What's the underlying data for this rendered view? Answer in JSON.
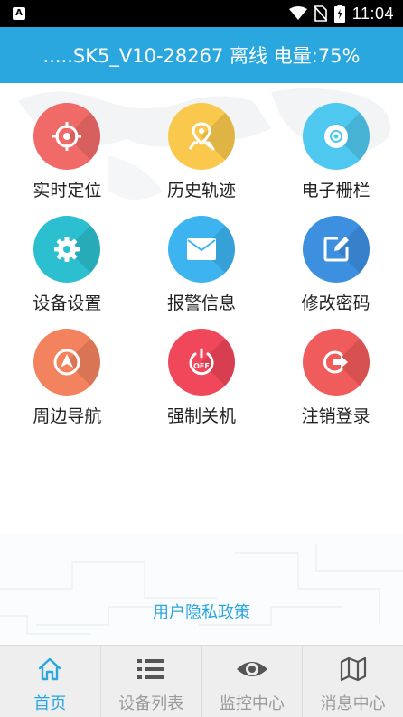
{
  "status_bar": {
    "time": "11:04",
    "icons": [
      "app-notification-icon",
      "wifi-icon",
      "no-sim-icon",
      "battery-charging-icon"
    ]
  },
  "header": {
    "title": ".....SK5_V10-28267 离线 电量:75%"
  },
  "menu": {
    "items": [
      {
        "label": "实时定位",
        "icon": "crosshair-icon",
        "color": "#f06a68"
      },
      {
        "label": "历史轨迹",
        "icon": "map-pin-icon",
        "color": "#f9c84c"
      },
      {
        "label": "电子栅栏",
        "icon": "disc-icon",
        "color": "#4ec8ee"
      },
      {
        "label": "设备设置",
        "icon": "gear-icon",
        "color": "#2cbfcf"
      },
      {
        "label": "报警信息",
        "icon": "envelope-icon",
        "color": "#3db4ef"
      },
      {
        "label": "修改密码",
        "icon": "edit-icon",
        "color": "#3d8fe0"
      },
      {
        "label": "周边导航",
        "icon": "navigation-icon",
        "color": "#f2835e"
      },
      {
        "label": "强制关机",
        "icon": "power-off-icon",
        "color": "#f0475a"
      },
      {
        "label": "注销登录",
        "icon": "logout-icon",
        "color": "#f05b5b"
      }
    ]
  },
  "footer": {
    "privacy_link": "用户隐私政策"
  },
  "bottom_nav": {
    "active_index": 0,
    "items": [
      {
        "label": "首页",
        "icon": "home-icon"
      },
      {
        "label": "设备列表",
        "icon": "list-icon"
      },
      {
        "label": "监控中心",
        "icon": "eye-icon"
      },
      {
        "label": "消息中心",
        "icon": "map-icon"
      }
    ]
  },
  "colors": {
    "accent": "#2aa7df",
    "nav_inactive": "#9a9a9a",
    "nav_background": "#eeeeee"
  }
}
